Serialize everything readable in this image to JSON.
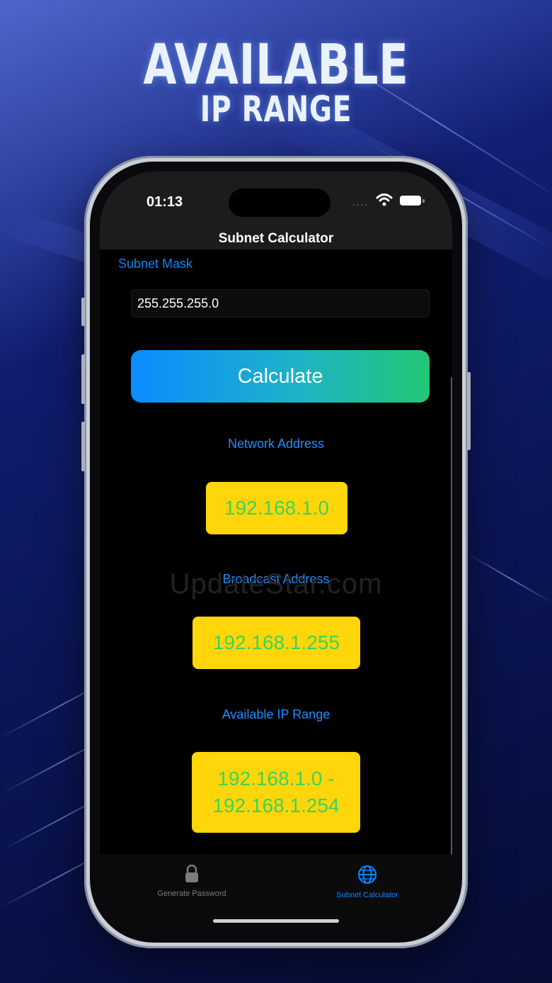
{
  "headline": {
    "line1": "AVAILABLE",
    "line2": "IP RANGE"
  },
  "status_bar": {
    "time": "01:13",
    "signal_dots": "....",
    "wifi_icon": "wifi-icon",
    "battery_icon": "battery-icon"
  },
  "nav": {
    "title": "Subnet Calculator"
  },
  "form": {
    "subnet_mask_label": "Subnet Mask",
    "subnet_mask_value": "255.255.255.0",
    "calculate_label": "Calculate"
  },
  "results": {
    "network_label": "Network Address",
    "network_value": "192.168.1.0",
    "broadcast_label": "Broadcast Address",
    "broadcast_value": "192.168.1.255",
    "range_label": "Available IP Range",
    "range_line1": "192.168.1.0 -",
    "range_line2": "192.168.1.254"
  },
  "watermark": "UpdateStar.com",
  "tabbar": {
    "tab1": {
      "label": "Generate Password",
      "icon": "lock-icon"
    },
    "tab2": {
      "label": "Subnet Calculator",
      "icon": "globe-icon"
    }
  },
  "colors": {
    "accent": "#0a84ff",
    "result_bg": "#ffd60a",
    "result_text": "#3dd35c",
    "button_gradient_start": "#0a8cff",
    "button_gradient_end": "#22c774"
  }
}
